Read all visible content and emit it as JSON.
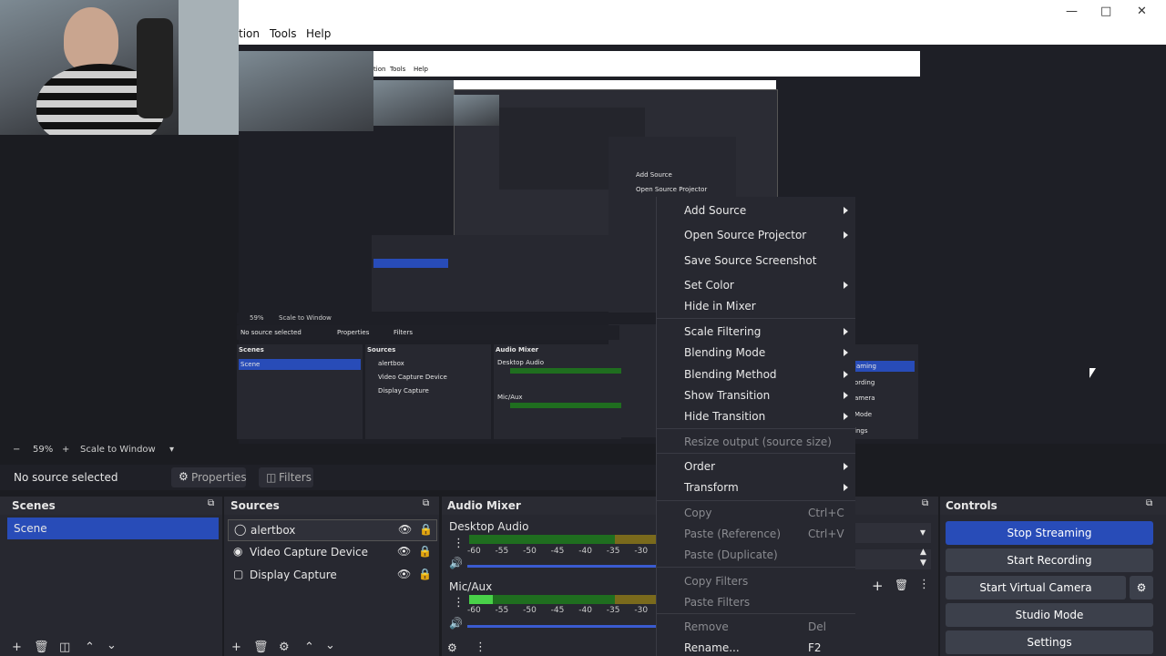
{
  "menubar": {
    "items": [
      "tion",
      "Tools",
      "Help"
    ]
  },
  "preview": {
    "nested_menu": [
      "tion",
      "Tools",
      "Help"
    ],
    "nested_status": "No source selected",
    "nested_scale": "Scale to Window",
    "nested_zoom": "59%",
    "nested_tabs": [
      "Properties",
      "Filters"
    ],
    "nested_scenes_header": "Scenes",
    "nested_sources_header": "Sources",
    "nested_mixer_header": "Audio Mixer",
    "nested_scene": "Scene",
    "nested_sources": [
      "alertbox",
      "Video Capture Device",
      "Display Capture"
    ],
    "nested_desktop_audio": "Desktop Audio",
    "nested_mic": "Mic/Aux",
    "nested_right_items": [
      "aming",
      "ording",
      "amera",
      "Mode",
      "ings"
    ]
  },
  "zoom": {
    "value": "59%",
    "scale_mode": "Scale to Window"
  },
  "source_bar": {
    "status": "No source selected",
    "properties": "Properties",
    "filters": "Filters"
  },
  "docks": {
    "scenes": {
      "title": "Scenes",
      "items": [
        "Scene"
      ]
    },
    "sources": {
      "title": "Sources",
      "items": [
        "alertbox",
        "Video Capture Device",
        "Display Capture"
      ]
    },
    "mixer": {
      "title": "Audio Mixer",
      "channels": [
        {
          "name": "Desktop Audio",
          "ticks": "-60 -55 -50 -45 -40 -35 -30 -25 -20 -15"
        },
        {
          "name": "Mic/Aux",
          "ticks": "-60 -55 -50 -45 -40 -35 -30 -25 -20 -15"
        }
      ]
    },
    "controls": {
      "title": "Controls",
      "buttons": [
        "Stop Streaming",
        "Start Recording",
        "Start Virtual Camera",
        "Studio Mode",
        "Settings"
      ]
    }
  },
  "context_menu": {
    "items": [
      {
        "label": "Add Source",
        "submenu": true
      },
      {
        "label": "Open Source Projector",
        "submenu": true
      },
      {
        "label": "Save Source Screenshot"
      },
      {
        "label": "Set Color",
        "submenu": true
      },
      {
        "label": "Hide in Mixer"
      },
      {
        "label": "Scale Filtering",
        "submenu": true
      },
      {
        "label": "Blending Mode",
        "submenu": true
      },
      {
        "label": "Blending Method",
        "submenu": true
      },
      {
        "label": "Show Transition",
        "submenu": true
      },
      {
        "label": "Hide Transition",
        "submenu": true
      },
      {
        "label": "Resize output (source size)",
        "disabled": true
      },
      {
        "label": "Order",
        "submenu": true
      },
      {
        "label": "Transform",
        "submenu": true
      },
      {
        "label": "Copy",
        "disabled": true,
        "shortcut": "Ctrl+C"
      },
      {
        "label": "Paste (Reference)",
        "disabled": true,
        "shortcut": "Ctrl+V"
      },
      {
        "label": "Paste (Duplicate)",
        "disabled": true
      },
      {
        "label": "Copy Filters",
        "disabled": true
      },
      {
        "label": "Paste Filters",
        "disabled": true
      },
      {
        "label": "Remove",
        "disabled": true,
        "shortcut": "Del"
      },
      {
        "label": "Rename...",
        "shortcut": "F2"
      }
    ]
  },
  "colors": {
    "accent": "#284cb8",
    "panel": "#272830",
    "background": "#1b1c21"
  },
  "icons": [
    "minimize-icon",
    "maximize-icon",
    "close-icon",
    "eye-icon",
    "lock-icon",
    "gear-icon",
    "plus-icon",
    "trash-icon",
    "up-icon",
    "down-icon",
    "speaker-icon"
  ]
}
